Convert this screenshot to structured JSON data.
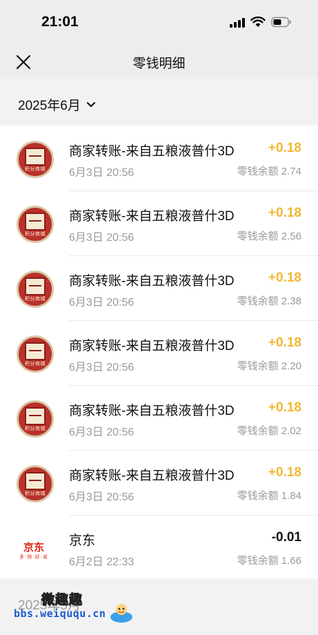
{
  "status_bar": {
    "time": "21:01",
    "icons": [
      "signal-icon",
      "wifi-icon",
      "battery-icon"
    ]
  },
  "nav": {
    "title": "零钱明细",
    "close_icon": "close-icon"
  },
  "month_filter": {
    "label": "2025年6月",
    "icon": "chevron-down-icon"
  },
  "transactions": [
    {
      "title": "商家转账-来自五粮液普什3D",
      "time": "6月3日 20:56",
      "amount": "+0.18",
      "balance": "零钱余额 2.74",
      "type": "income",
      "avatar": "merchant-logo",
      "avatar_caption": "积分商城"
    },
    {
      "title": "商家转账-来自五粮液普什3D",
      "time": "6月3日 20:56",
      "amount": "+0.18",
      "balance": "零钱余额 2.56",
      "type": "income",
      "avatar": "merchant-logo",
      "avatar_caption": "积分商城"
    },
    {
      "title": "商家转账-来自五粮液普什3D",
      "time": "6月3日 20:56",
      "amount": "+0.18",
      "balance": "零钱余额 2.38",
      "type": "income",
      "avatar": "merchant-logo",
      "avatar_caption": "积分商城"
    },
    {
      "title": "商家转账-来自五粮液普什3D",
      "time": "6月3日 20:56",
      "amount": "+0.18",
      "balance": "零钱余额 2.20",
      "type": "income",
      "avatar": "merchant-logo",
      "avatar_caption": "积分商城"
    },
    {
      "title": "商家转账-来自五粮液普什3D",
      "time": "6月3日 20:56",
      "amount": "+0.18",
      "balance": "零钱余额 2.02",
      "type": "income",
      "avatar": "merchant-logo",
      "avatar_caption": "积分商城"
    },
    {
      "title": "商家转账-来自五粮液普什3D",
      "time": "6月3日 20:56",
      "amount": "+0.18",
      "balance": "零钱余额 1.84",
      "type": "income",
      "avatar": "merchant-logo",
      "avatar_caption": "积分商城"
    },
    {
      "title": "京东",
      "time": "6月2日 22:33",
      "amount": "-0.01",
      "balance": "零钱余额 1.66",
      "type": "expense",
      "avatar": "jd-logo",
      "avatar_caption": "京东",
      "avatar_sub": "多·快·好·省"
    }
  ],
  "next_month": {
    "label": "2025年5月"
  },
  "watermark": {
    "top": "微趣趣",
    "url": "bbs.weiququ.cn"
  },
  "colors": {
    "income": "#f3b733",
    "expense": "#111111",
    "background": "#ededed",
    "secondary_text": "#9a9a9a"
  }
}
